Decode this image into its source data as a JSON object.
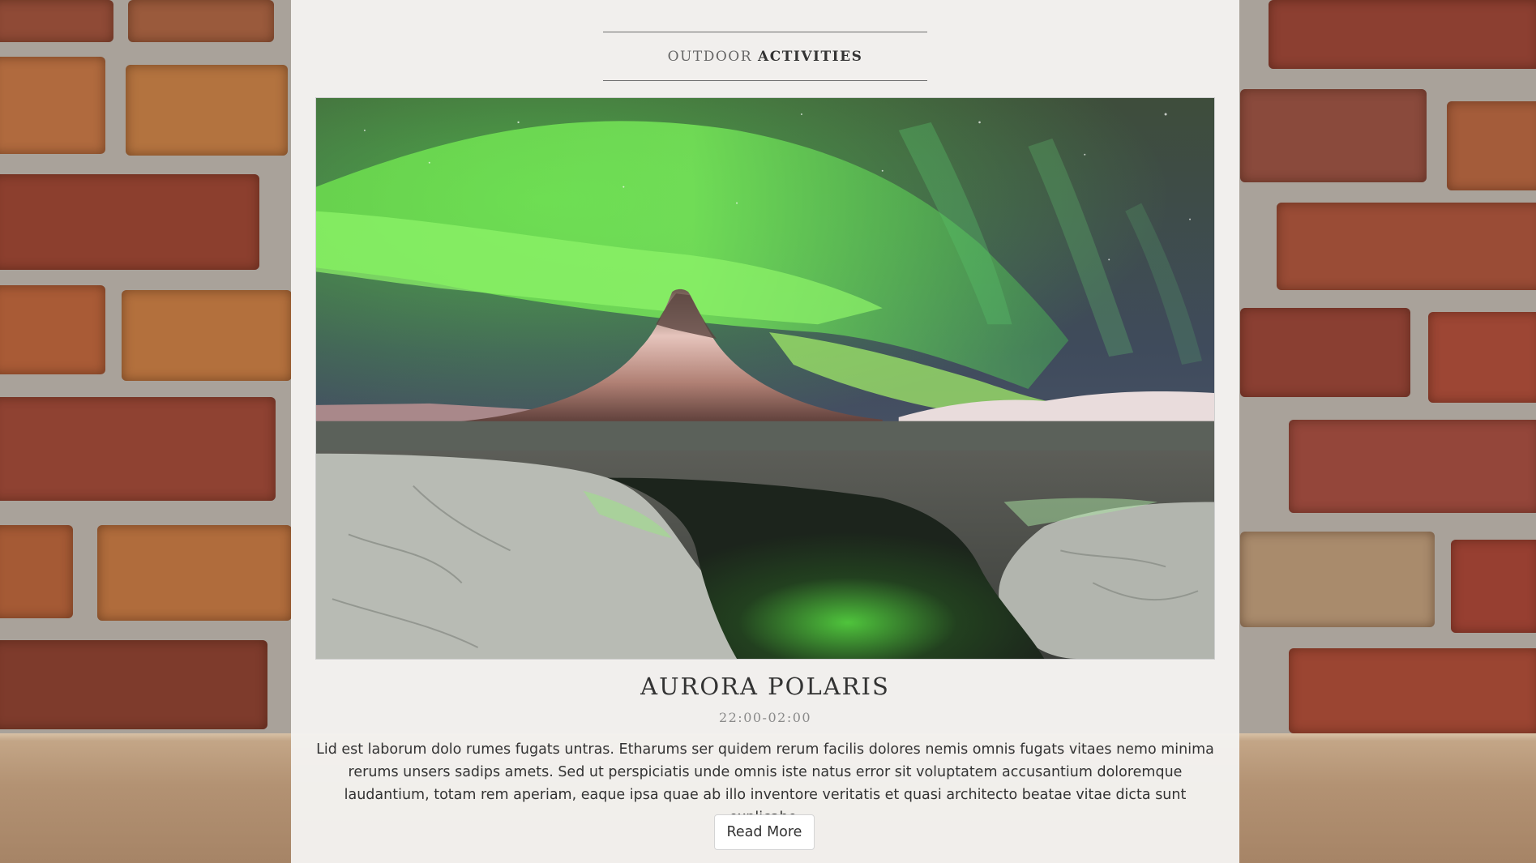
{
  "section": {
    "title_light": "OUTDOOR",
    "title_bold": "ACTIVITIES"
  },
  "event": {
    "title": "AURORA POLARIS",
    "time": "22:00-02:00",
    "description": "Lid est laborum dolo rumes fugats untras. Etharums ser quidem rerum facilis dolores nemis omnis fugats vitaes nemo minima rerums unsers sadips amets. Sed ut perspiciatis unde omnis iste natus error sit voluptatem accusantium doloremque laudantium, totam rem aperiam, eaque ipsa quae ab illo inventore veritatis et quasi architecto beatae vitae dicta sunt explicabo.",
    "button_label": "Read More"
  },
  "colors": {
    "panel_bg": "#f4f2f0",
    "text": "#333333",
    "muted_text": "#8a8a8a",
    "aurora_green": "#5ee04a",
    "brick": "#9c4e38"
  }
}
